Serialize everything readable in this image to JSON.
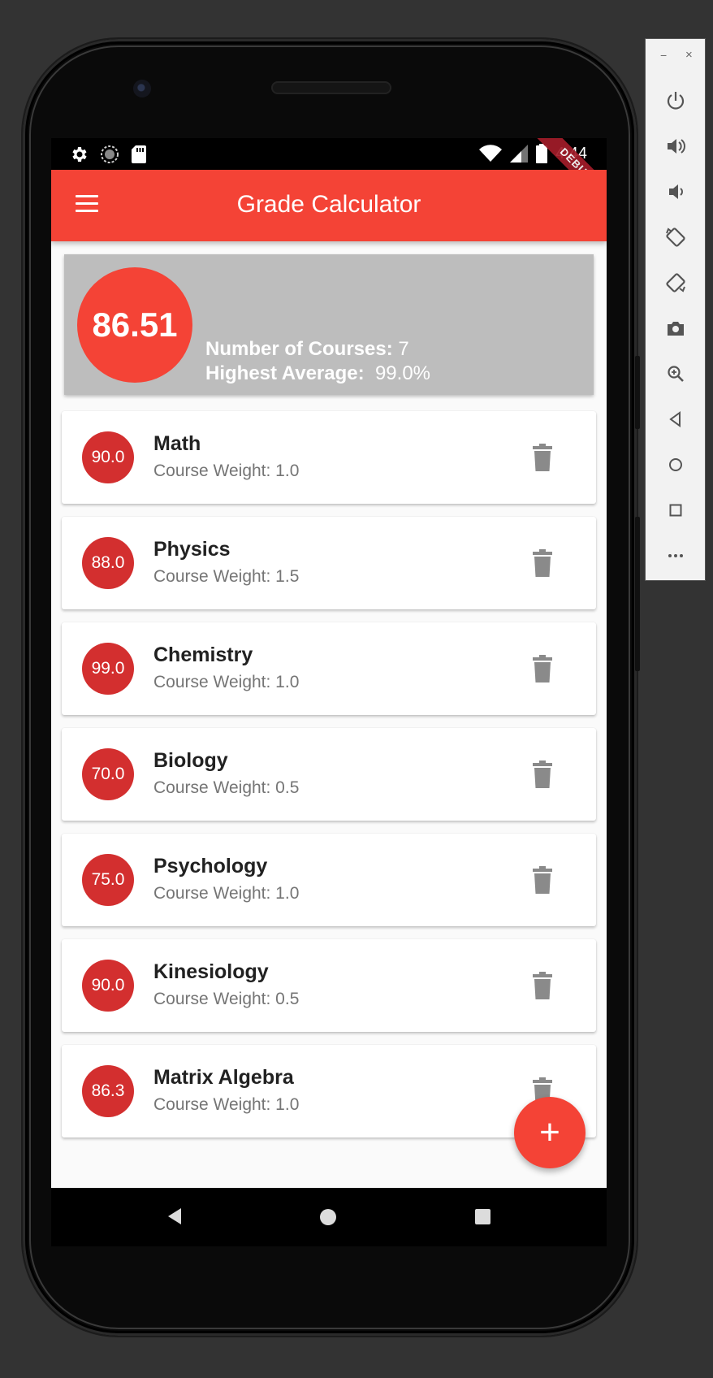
{
  "status_bar": {
    "time": "4:44",
    "debug_label": "DEBUG"
  },
  "app_bar": {
    "title": "Grade Calculator"
  },
  "summary": {
    "average": "86.51",
    "courses_label": "Number of Courses:",
    "courses_value": "7",
    "highest_label": "Highest Average:",
    "highest_value": "99.0%"
  },
  "courses": [
    {
      "grade": "90.0",
      "name": "Math",
      "weight": "Course Weight: 1.0"
    },
    {
      "grade": "88.0",
      "name": "Physics",
      "weight": "Course Weight: 1.5"
    },
    {
      "grade": "99.0",
      "name": "Chemistry",
      "weight": "Course Weight: 1.0"
    },
    {
      "grade": "70.0",
      "name": "Biology",
      "weight": "Course Weight: 0.5"
    },
    {
      "grade": "75.0",
      "name": "Psychology",
      "weight": "Course Weight: 1.0"
    },
    {
      "grade": "90.0",
      "name": "Kinesiology",
      "weight": "Course Weight: 0.5"
    },
    {
      "grade": "86.3",
      "name": "Matrix Algebra",
      "weight": "Course Weight: 1.0"
    }
  ],
  "fab": {
    "label": "+"
  },
  "colors": {
    "primary": "#f44336",
    "grade_circle": "#d32f2f",
    "summary_bg": "#bdbdbd"
  },
  "emulator_toolbar": {
    "minimize": "−",
    "close": "×",
    "buttons": [
      "power-icon",
      "volume-up-icon",
      "volume-down-icon",
      "rotate-left-icon",
      "rotate-right-icon",
      "camera-icon",
      "zoom-icon",
      "back-icon",
      "home-icon",
      "overview-icon",
      "more-icon"
    ]
  }
}
